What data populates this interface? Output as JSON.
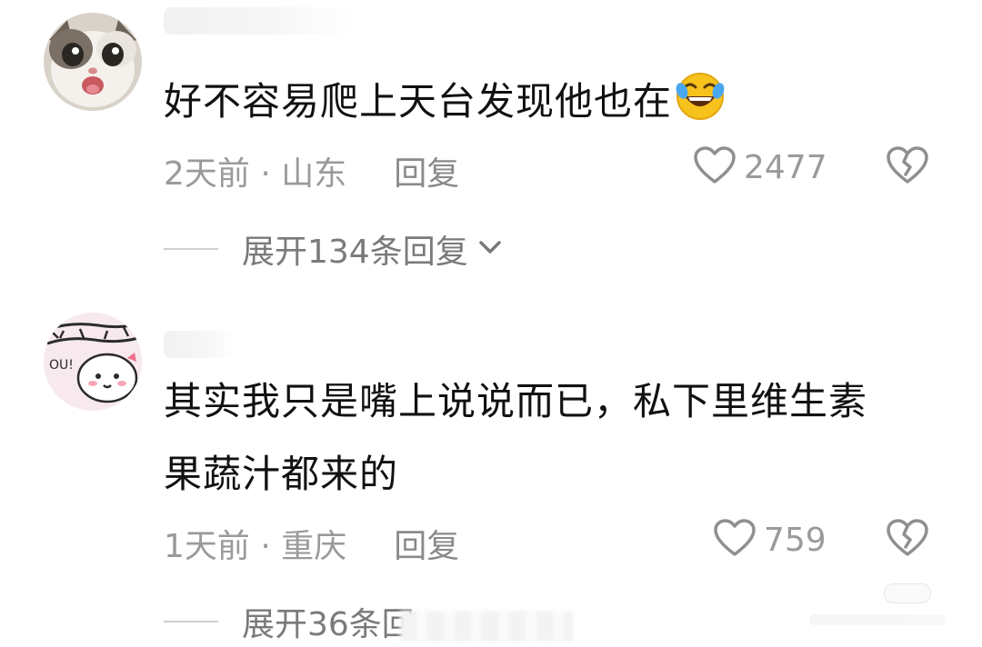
{
  "comments": [
    {
      "text": "好不容易爬上天台发现他也在",
      "emoji": "rolling-on-floor-laughing-emoji",
      "time": "2天前",
      "separator": " · ",
      "location": "山东",
      "reply_label": "回复",
      "likes": "2477",
      "expand_label": "展开134条回复"
    },
    {
      "text_line1": "其实我只是嘴上说说而已，私下里维生素",
      "text_line2": "果蔬汁都来的",
      "time": "1天前",
      "separator": " · ",
      "location": "重庆",
      "reply_label": "回复",
      "likes": "759",
      "expand_label": "展开36条回"
    }
  ],
  "icons": {
    "like": "heart-outline-icon",
    "dislike": "broken-heart-icon",
    "expand": "chevron-down-icon"
  },
  "colors": {
    "text": "#111111",
    "meta": "#9a9a9a",
    "icon": "#8f8f8f"
  }
}
